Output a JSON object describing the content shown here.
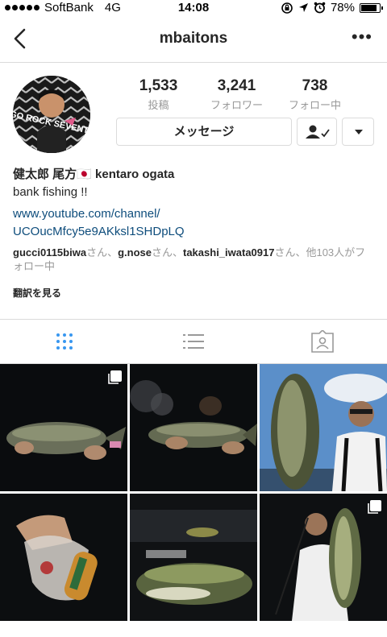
{
  "status": {
    "carrier": "SoftBank",
    "network": "4G",
    "time": "14:08",
    "battery": "78%",
    "battery_level": 0.78
  },
  "nav": {
    "title": "mbaitons"
  },
  "stats": [
    {
      "num": "1,533",
      "label": "投稿"
    },
    {
      "num": "3,241",
      "label": "フォロワー"
    },
    {
      "num": "738",
      "label": "フォロー中"
    }
  ],
  "actions": {
    "message": "メッセージ"
  },
  "profile": {
    "name": "健太郎 尾方🇯🇵 kentaro ogata",
    "bio": "bank fishing !!",
    "link_line1": "www.youtube.com/channel/",
    "link_line2": "UCOucMfcy5e9AKksl1SHDpLQ",
    "followed_user1": "gucci0115biwa",
    "followed_sep1": "さん、",
    "followed_user2": "g.nose",
    "followed_sep2": "さん、",
    "followed_user3": "takashi_iwata0917",
    "followed_tail": "さん、他103人がフォロー中",
    "translate": "翻訳を見る"
  },
  "avatar_text": "GO ROCK SEVENTY",
  "colors": {
    "link": "#0e4d7c",
    "active_tab": "#3897f0",
    "muted": "#999999"
  }
}
